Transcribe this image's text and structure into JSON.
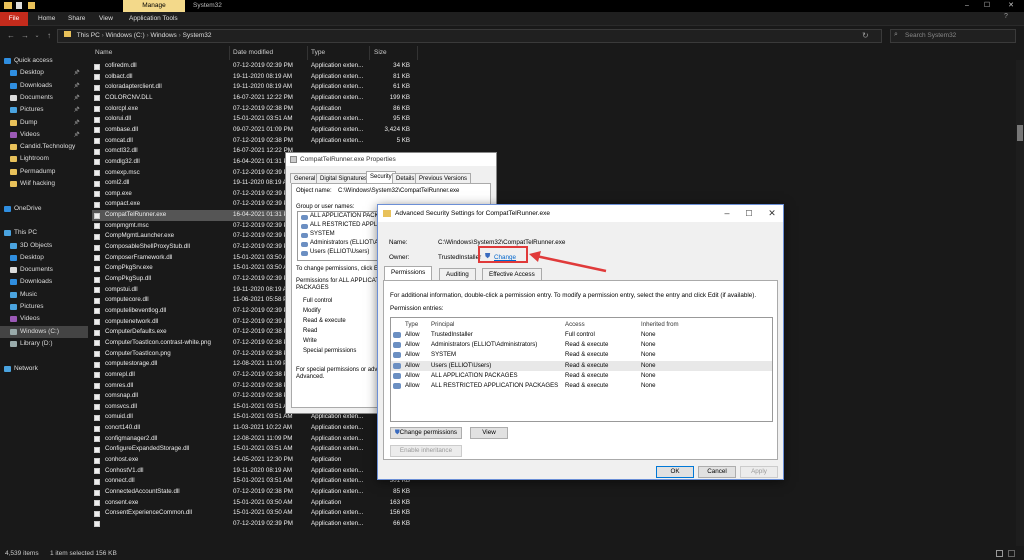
{
  "window": {
    "manage_tab": "Manage",
    "folder_title": "System32",
    "controls": [
      "–",
      "☐",
      "✕"
    ]
  },
  "ribbon": {
    "file": "File",
    "tabs": [
      "Home",
      "Share",
      "View",
      "Application Tools"
    ]
  },
  "address": {
    "path": [
      "This PC",
      "Windows (C:)",
      "Windows",
      "System32"
    ],
    "search_placeholder": "Search System32"
  },
  "nav": [
    {
      "label": "Quick access",
      "icon": "star-icon",
      "color": "#2f8ee0",
      "indent": 0,
      "pinned": false
    },
    {
      "label": "Desktop",
      "icon": "desktop-icon",
      "color": "#2f8ee0",
      "indent": 1,
      "pinned": true
    },
    {
      "label": "Downloads",
      "icon": "download-icon",
      "color": "#2f8ee0",
      "indent": 1,
      "pinned": true
    },
    {
      "label": "Documents",
      "icon": "document-icon",
      "color": "#dcdcdc",
      "indent": 1,
      "pinned": true
    },
    {
      "label": "Pictures",
      "icon": "picture-icon",
      "color": "#4aa3df",
      "indent": 1,
      "pinned": true
    },
    {
      "label": "Dump",
      "icon": "folder-icon",
      "color": "#e8c15a",
      "indent": 1,
      "pinned": true
    },
    {
      "label": "Videos",
      "icon": "video-icon",
      "color": "#9b59b6",
      "indent": 1,
      "pinned": true
    },
    {
      "label": "Candid.Technology",
      "icon": "folder-icon",
      "color": "#e8c15a",
      "indent": 1,
      "pinned": false
    },
    {
      "label": "Lightroom",
      "icon": "folder-icon",
      "color": "#e8c15a",
      "indent": 1,
      "pinned": false
    },
    {
      "label": "Permadump",
      "icon": "folder-icon",
      "color": "#e8c15a",
      "indent": 1,
      "pinned": false
    },
    {
      "label": "Wiif hacking",
      "icon": "folder-icon",
      "color": "#e8c15a",
      "indent": 1,
      "pinned": false
    },
    {
      "label": "",
      "icon": "",
      "color": "",
      "indent": 0,
      "pinned": false
    },
    {
      "label": "OneDrive",
      "icon": "cloud-icon",
      "color": "#2f8ee0",
      "indent": 0,
      "pinned": false
    },
    {
      "label": "",
      "icon": "",
      "color": "",
      "indent": 0,
      "pinned": false
    },
    {
      "label": "This PC",
      "icon": "pc-icon",
      "color": "#4aa3df",
      "indent": 0,
      "pinned": false
    },
    {
      "label": "3D Objects",
      "icon": "cube-icon",
      "color": "#4aa3df",
      "indent": 1,
      "pinned": false
    },
    {
      "label": "Desktop",
      "icon": "desktop-icon",
      "color": "#2f8ee0",
      "indent": 1,
      "pinned": false
    },
    {
      "label": "Documents",
      "icon": "document-icon",
      "color": "#dcdcdc",
      "indent": 1,
      "pinned": false
    },
    {
      "label": "Downloads",
      "icon": "download-icon",
      "color": "#2f8ee0",
      "indent": 1,
      "pinned": false
    },
    {
      "label": "Music",
      "icon": "music-icon",
      "color": "#4aa3df",
      "indent": 1,
      "pinned": false
    },
    {
      "label": "Pictures",
      "icon": "picture-icon",
      "color": "#4aa3df",
      "indent": 1,
      "pinned": false
    },
    {
      "label": "Videos",
      "icon": "video-icon",
      "color": "#9b59b6",
      "indent": 1,
      "pinned": false
    },
    {
      "label": "Windows (C:)",
      "icon": "drive-icon",
      "color": "#9aa",
      "indent": 1,
      "pinned": false,
      "selected": true
    },
    {
      "label": "Library (D:)",
      "icon": "drive-icon",
      "color": "#9aa",
      "indent": 1,
      "pinned": false
    },
    {
      "label": "",
      "icon": "",
      "color": "",
      "indent": 0,
      "pinned": false
    },
    {
      "label": "Network",
      "icon": "network-icon",
      "color": "#4aa3df",
      "indent": 0,
      "pinned": false
    }
  ],
  "columns": {
    "name": "Name",
    "date": "Date modified",
    "type": "Type",
    "size": "Size"
  },
  "files": [
    [
      "cofiredm.dll",
      "07-12-2019 02:39 PM",
      "Application exten...",
      "34 KB"
    ],
    [
      "colbact.dll",
      "19-11-2020 08:19 AM",
      "Application exten...",
      "81 KB"
    ],
    [
      "coloradapterclient.dll",
      "19-11-2020 08:19 AM",
      "Application exten...",
      "61 KB"
    ],
    [
      "COLORCNV.DLL",
      "16-07-2021 12:22 PM",
      "Application exten...",
      "199 KB"
    ],
    [
      "colorcpl.exe",
      "07-12-2019 02:38 PM",
      "Application",
      "86 KB"
    ],
    [
      "colorui.dll",
      "15-01-2021 03:51 AM",
      "Application exten...",
      "95 KB"
    ],
    [
      "combase.dll",
      "09-07-2021 01:09 PM",
      "Application exten...",
      "3,424 KB"
    ],
    [
      "comcat.dll",
      "07-12-2019 02:38 PM",
      "Application exten...",
      "5 KB"
    ],
    [
      "comctl32.dll",
      "16-07-2021 12:22 PM",
      "",
      ""
    ],
    [
      "comdlg32.dll",
      "16-04-2021 01:31 PM",
      "",
      ""
    ],
    [
      "comexp.msc",
      "07-12-2019 02:39 PM",
      "",
      ""
    ],
    [
      "coml2.dll",
      "19-11-2020 08:19 AM",
      "",
      ""
    ],
    [
      "comp.exe",
      "07-12-2019 02:39 PM",
      "",
      ""
    ],
    [
      "compact.exe",
      "07-12-2019 02:39 PM",
      "",
      ""
    ],
    [
      "CompatTelRunner.exe",
      "16-04-2021 01:31 PM",
      "",
      ""
    ],
    [
      "compmgmt.msc",
      "07-12-2019 02:39 PM",
      "",
      ""
    ],
    [
      "CompMgmtLauncher.exe",
      "07-12-2019 02:39 PM",
      "",
      ""
    ],
    [
      "ComposableShellProxyStub.dll",
      "07-12-2019 02:39 PM",
      "",
      ""
    ],
    [
      "ComposerFramework.dll",
      "15-01-2021 03:50 AM",
      "",
      ""
    ],
    [
      "CompPkgSrv.exe",
      "15-01-2021 03:50 AM",
      "",
      ""
    ],
    [
      "CompPkgSup.dll",
      "07-12-2019 02:39 PM",
      "",
      ""
    ],
    [
      "compstui.dll",
      "19-11-2020 08:19 AM",
      "",
      ""
    ],
    [
      "computecore.dll",
      "11-06-2021 05:58 PM",
      "",
      ""
    ],
    [
      "computelibeventlog.dll",
      "07-12-2019 02:39 PM",
      "",
      ""
    ],
    [
      "computenetwork.dll",
      "07-12-2019 02:39 PM",
      "",
      ""
    ],
    [
      "ComputerDefaults.exe",
      "07-12-2019 02:38 PM",
      "",
      ""
    ],
    [
      "ComputerToastIcon.contrast-white.png",
      "07-12-2019 02:38 PM",
      "",
      ""
    ],
    [
      "ComputerToastIcon.png",
      "07-12-2019 02:38 PM",
      "",
      ""
    ],
    [
      "computestorage.dll",
      "12-08-2021 11:09 PM",
      "",
      ""
    ],
    [
      "comrepl.dll",
      "07-12-2019 02:38 PM",
      "",
      ""
    ],
    [
      "comres.dll",
      "07-12-2019 02:38 PM",
      "",
      ""
    ],
    [
      "comsnap.dll",
      "07-12-2019 02:38 PM",
      "",
      ""
    ],
    [
      "comsvcs.dll",
      "15-01-2021 03:51 AM",
      "Application exten...",
      ""
    ],
    [
      "comuid.dll",
      "15-01-2021 03:51 AM",
      "Application exten...",
      ""
    ],
    [
      "concrt140.dll",
      "11-03-2021 10:22 AM",
      "Application exten...",
      ""
    ],
    [
      "configmanager2.dll",
      "12-08-2021 11:09 PM",
      "Application exten...",
      ""
    ],
    [
      "ConfigureExpandedStorage.dll",
      "15-01-2021 03:51 AM",
      "Application exten...",
      ""
    ],
    [
      "conhost.exe",
      "14-05-2021 12:30 PM",
      "Application",
      ""
    ],
    [
      "ConhostV1.dll",
      "19-11-2020 08:19 AM",
      "Application exten...",
      "520 KB"
    ],
    [
      "connect.dll",
      "15-01-2021 03:51 AM",
      "Application exten...",
      "301 KB"
    ],
    [
      "ConnectedAccountState.dll",
      "07-12-2019 02:38 PM",
      "Application exten...",
      "85 KB"
    ],
    [
      "consent.exe",
      "15-01-2021 03:50 AM",
      "Application",
      "163 KB"
    ],
    [
      "ConsentExperienceCommon.dll",
      "15-01-2021 03:50 AM",
      "Application exten...",
      "156 KB"
    ],
    [
      "",
      "07-12-2019 02:39 PM",
      "Application exten...",
      "66 KB"
    ]
  ],
  "status": {
    "items": "4,539 items",
    "selected": "1 item selected  156 KB"
  },
  "properties": {
    "title": "CompatTelRunner.exe Properties",
    "tabs": [
      "General",
      "Digital Signatures",
      "Security",
      "Details",
      "Previous Versions"
    ],
    "object_label": "Object name:",
    "object_value": "C:\\Windows\\System32\\CompatTelRunner.exe",
    "group_label": "Group or user names:",
    "groups": [
      "ALL APPLICATION PACKA",
      "ALL RESTRICTED APPLIC",
      "SYSTEM",
      "Administrators (ELLIOT\\Adr",
      "Users (ELLIOT\\Users)"
    ],
    "change_text": "To change permissions, click Ed",
    "perm_header": "Permissions for ALL APPLICATI",
    "perm_header2": "PACKAGES",
    "perms": [
      "Full control",
      "Modify",
      "Read & execute",
      "Read",
      "Write",
      "Special permissions"
    ],
    "special_text": "For special permissions or advan",
    "special_text2": "Advanced."
  },
  "advanced": {
    "title": "Advanced Security Settings for CompatTelRunner.exe",
    "name_label": "Name:",
    "name_value": "C:\\Windows\\System32\\CompatTelRunner.exe",
    "owner_label": "Owner:",
    "owner_value": "TrustedInstaller",
    "change_link": "Change",
    "tabs": [
      "Permissions",
      "Auditing",
      "Effective Access"
    ],
    "info": "For additional information, double-click a permission entry. To modify a permission entry, select the entry and click Edit (if available).",
    "entries_label": "Permission entries:",
    "headers": [
      "Type",
      "Principal",
      "Access",
      "Inherited from"
    ],
    "entries": [
      [
        "Allow",
        "TrustedInstaller",
        "Full control",
        "None"
      ],
      [
        "Allow",
        "Administrators (ELLIOT\\Administrators)",
        "Read & execute",
        "None"
      ],
      [
        "Allow",
        "SYSTEM",
        "Read & execute",
        "None"
      ],
      [
        "Allow",
        "Users (ELLIOT\\Users)",
        "Read & execute",
        "None"
      ],
      [
        "Allow",
        "ALL APPLICATION PACKAGES",
        "Read & execute",
        "None"
      ],
      [
        "Allow",
        "ALL RESTRICTED APPLICATION PACKAGES",
        "Read & execute",
        "None"
      ]
    ],
    "buttons": {
      "change_permissions": "Change permissions",
      "view": "View",
      "enable_inheritance": "Enable inheritance",
      "ok": "OK",
      "cancel": "Cancel",
      "apply": "Apply"
    }
  },
  "accent": {
    "highlight": "#e03a3a",
    "file_tab": "#c42b1c",
    "manage": "#f3d98a"
  }
}
